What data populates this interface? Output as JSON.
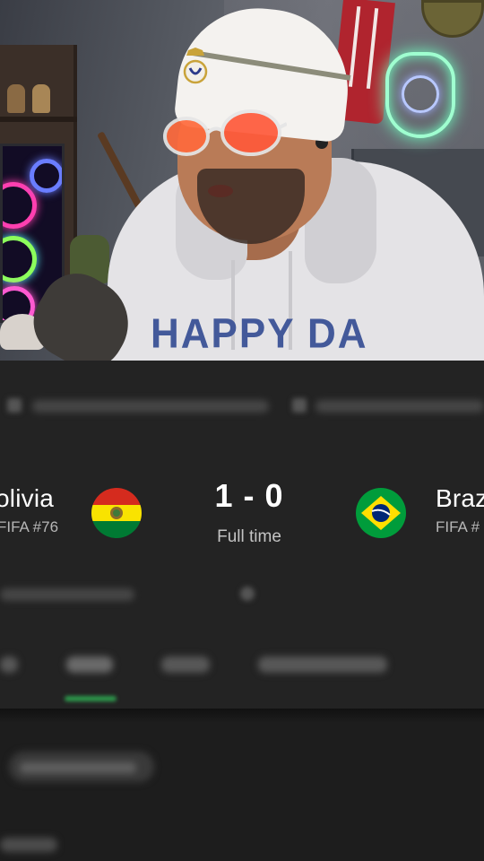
{
  "stream": {
    "hoodie_print": "HAPPY DA"
  },
  "match": {
    "home": {
      "name": "olivia",
      "rank": "FIFA #76",
      "flag_colors": [
        "#d52b1e",
        "#f9e300",
        "#007a33"
      ]
    },
    "away": {
      "name": "Braz",
      "rank": "FIFA #",
      "flag_colors": [
        "#009c3b",
        "#ffdf00",
        "#002776"
      ]
    },
    "score": "1 - 0",
    "status": "Full time"
  },
  "colors": {
    "panel_bg": "#232323",
    "page_bg": "#1d1d1d",
    "accent_tab": "#2d9a4c",
    "muted_text": "#b7b7b7"
  }
}
